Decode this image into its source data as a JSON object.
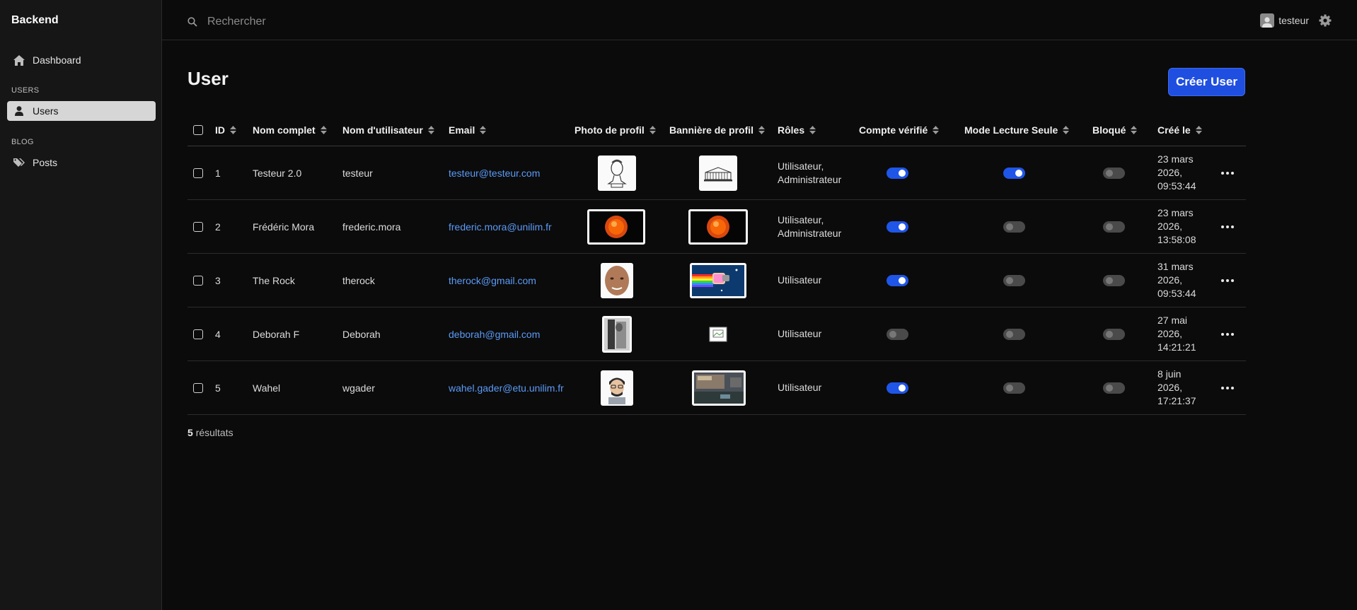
{
  "sidebar": {
    "brand": "Backend",
    "dashboard": "Dashboard",
    "section_users": "USERS",
    "users": "Users",
    "section_blog": "BLOG",
    "posts": "Posts"
  },
  "topbar": {
    "search_placeholder": "Rechercher",
    "username": "testeur"
  },
  "main": {
    "title": "User",
    "create_button": "Créer User"
  },
  "table": {
    "columns": {
      "id": "ID",
      "full_name": "Nom complet",
      "username": "Nom d'utilisateur",
      "email": "Email",
      "photo": "Photo de profil",
      "banner": "Bannière de profil",
      "roles": "Rôles",
      "verified": "Compte vérifié",
      "readonly": "Mode Lecture Seule",
      "blocked": "Bloqué",
      "created": "Créé le"
    },
    "rows": [
      {
        "id": "1",
        "full_name": "Testeur 2.0",
        "username": "testeur",
        "email": "testeur@testeur.com",
        "roles_line1": "Utilisateur,",
        "roles_line2": "Administrateur",
        "verified": true,
        "readonly": true,
        "blocked": false,
        "created_line1": "23 mars",
        "created_line2": "2026,",
        "created_line3": "09:53:44"
      },
      {
        "id": "2",
        "full_name": "Frédéric Mora",
        "username": "frederic.mora",
        "email": "frederic.mora@unilim.fr",
        "roles_line1": "Utilisateur,",
        "roles_line2": "Administrateur",
        "verified": true,
        "readonly": false,
        "blocked": false,
        "created_line1": "23 mars",
        "created_line2": "2026,",
        "created_line3": "13:58:08"
      },
      {
        "id": "3",
        "full_name": "The Rock",
        "username": "therock",
        "email": "therock@gmail.com",
        "roles_line1": "Utilisateur",
        "roles_line2": "",
        "verified": true,
        "readonly": false,
        "blocked": false,
        "created_line1": "31 mars",
        "created_line2": "2026,",
        "created_line3": "09:53:44"
      },
      {
        "id": "4",
        "full_name": "Deborah F",
        "username": "Deborah",
        "email": "deborah@gmail.com",
        "roles_line1": "Utilisateur",
        "roles_line2": "",
        "verified": false,
        "readonly": false,
        "blocked": false,
        "created_line1": "27 mai",
        "created_line2": "2026,",
        "created_line3": "14:21:21"
      },
      {
        "id": "5",
        "full_name": "Wahel",
        "username": "wgader",
        "email": "wahel.gader@etu.unilim.fr",
        "roles_line1": "Utilisateur",
        "roles_line2": "",
        "verified": true,
        "readonly": false,
        "blocked": false,
        "created_line1": "8 juin",
        "created_line2": "2026,",
        "created_line3": "17:21:37"
      }
    ],
    "results_count": "5",
    "results_label": "résultats"
  }
}
